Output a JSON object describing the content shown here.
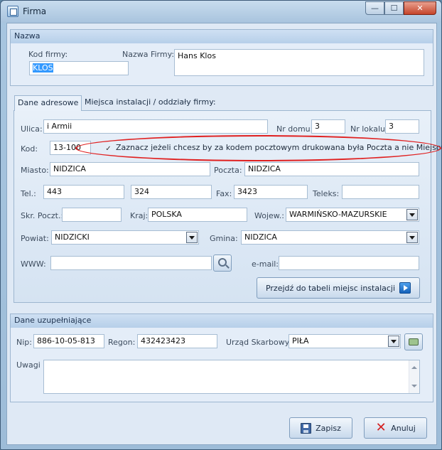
{
  "window": {
    "title": "Firma",
    "minimize": "—",
    "maximize": "☐",
    "close": "✕"
  },
  "nazwa": {
    "header": "Nazwa",
    "kod_label": "Kod firmy:",
    "kod_value": "KLOS",
    "nazwa_label": "Nazwa Firmy:",
    "nazwa_value": "Hans Klos"
  },
  "tabs": [
    {
      "label": "Dane adresowe",
      "active": true
    },
    {
      "label": "Miejsca instalacji / oddziały firmy:",
      "active": false
    }
  ],
  "address": {
    "ulica_label": "Ulica:",
    "ulica_value": "i Armii",
    "nr_domu_label": "Nr domu:",
    "nr_domu_value": "3",
    "nr_lokalu_label": "Nr lokalu:",
    "nr_lokalu_value": "3",
    "kod_label": "Kod:",
    "kod_value": "13-100",
    "checkbox_mark": "✓",
    "checkbox_label": "Zaznacz jeżeli chcesz by za kodem pocztowym drukowana była Poczta a nie Miejsowość",
    "miasto_label": "Miasto:",
    "miasto_value": "NIDZICA",
    "poczta_label": "Poczta:",
    "poczta_value": "NIDZICA",
    "tel_label": "Tel.:",
    "tel1_value": "443",
    "tel2_value": "324",
    "fax_label": "Fax:",
    "fax_value": "3423",
    "teleks_label": "Teleks:",
    "teleks_value": "",
    "skr_label": "Skr. Poczt.:",
    "skr_value": "",
    "kraj_label": "Kraj:",
    "kraj_value": "POLSKA",
    "woj_label": "Wojew.:",
    "woj_value": "WARMIŃSKO-MAZURSKIE",
    "powiat_label": "Powiat:",
    "powiat_value": "NIDZICKI",
    "gmina_label": "Gmina:",
    "gmina_value": "NIDZICA",
    "www_label": "WWW:",
    "www_value": "",
    "email_label": "e-mail:",
    "email_value": "",
    "goto_button": "Przejdź do tabeli miejsc instalacji"
  },
  "extra": {
    "header": "Dane uzupełniające",
    "nip_label": "Nip:",
    "nip_value": "886-10-05-813",
    "regon_label": "Regon:",
    "regon_value": "432423423",
    "urzad_label": "Urząd Skarbowy:",
    "urzad_value": "PIŁA",
    "uwagi_label": "Uwagi",
    "uwagi_value": ""
  },
  "footer": {
    "save": "Zapisz",
    "cancel": "Anuluj"
  },
  "colors": {
    "highlight": "#e02020",
    "selection": "#3399ff"
  }
}
